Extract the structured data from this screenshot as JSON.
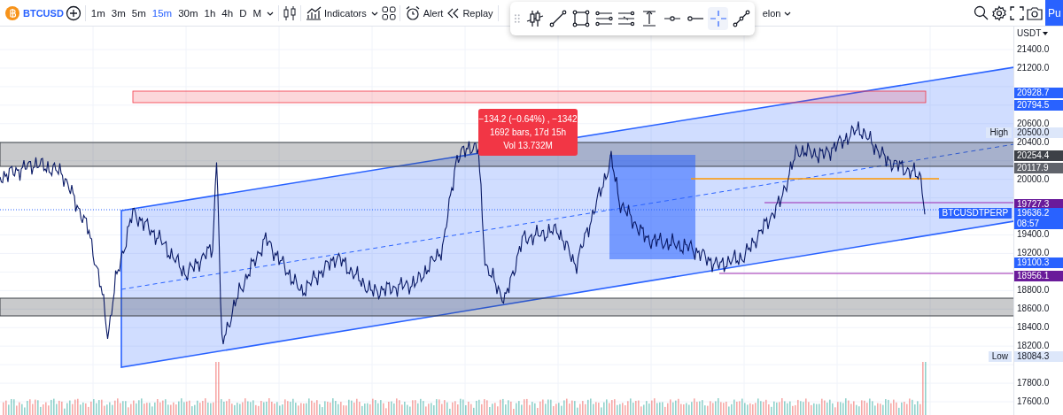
{
  "toolbar": {
    "symbol": "BTCUSD",
    "intervals": [
      {
        "label": "1m",
        "selected": false
      },
      {
        "label": "3m",
        "selected": false
      },
      {
        "label": "5m",
        "selected": false
      },
      {
        "label": "15m",
        "selected": true
      },
      {
        "label": "30m",
        "selected": false
      },
      {
        "label": "1h",
        "selected": false
      },
      {
        "label": "4h",
        "selected": false
      },
      {
        "label": "D",
        "selected": false
      },
      {
        "label": "M",
        "selected": false
      }
    ],
    "indicators": "Indicators",
    "alert": "Alert",
    "replay": "Replay",
    "layout_name": "elon",
    "publish": "Pu"
  },
  "drawing_tools": [
    {
      "kind": "pattern",
      "selected": false
    },
    {
      "kind": "trend-line",
      "selected": false
    },
    {
      "kind": "rectangle",
      "selected": false
    },
    {
      "kind": "parallel-channel",
      "selected": false
    },
    {
      "kind": "regression",
      "selected": false
    },
    {
      "kind": "price-range",
      "selected": false
    },
    {
      "kind": "horizontal-ray",
      "selected": false
    },
    {
      "kind": "ray",
      "selected": false
    },
    {
      "kind": "crosshair",
      "selected": true
    },
    {
      "kind": "path",
      "selected": false
    }
  ],
  "measure_tooltip": [
    "−134.2 (−0.64%) , −1342",
    "1692 bars, 17d 15h",
    "Vol 13.732M"
  ],
  "price_axis": {
    "currency": "USDT",
    "ticks": [
      "21400.0",
      "21200.0",
      "20600.0",
      "20400.0",
      "20000.0",
      "19400.0",
      "19200.0",
      "18800.0",
      "18600.0",
      "18400.0",
      "18200.0",
      "17800.0",
      "17600.0"
    ],
    "badges": [
      {
        "value": "20928.7",
        "color": "#2962ff"
      },
      {
        "value": "20794.5",
        "color": "#2962ff"
      },
      {
        "value": "20500.0",
        "color": "#dde7fa",
        "tag": "High"
      },
      {
        "value": "20254.4",
        "color": "#3d4047"
      },
      {
        "value": "20117.9",
        "color": "#60636b"
      },
      {
        "value": "19727.3",
        "color": "#6a1b9a"
      },
      {
        "value": "19636.2",
        "color": "#2962ff",
        "tag": "BTCUSDTPERP",
        "countdown": "08:57"
      },
      {
        "value": "19100.3",
        "color": "#2962ff"
      },
      {
        "value": "18956.1",
        "color": "#6a1b9a"
      },
      {
        "value": "18084.3",
        "color": "#dde7fa",
        "tag": "Low"
      }
    ]
  }
}
